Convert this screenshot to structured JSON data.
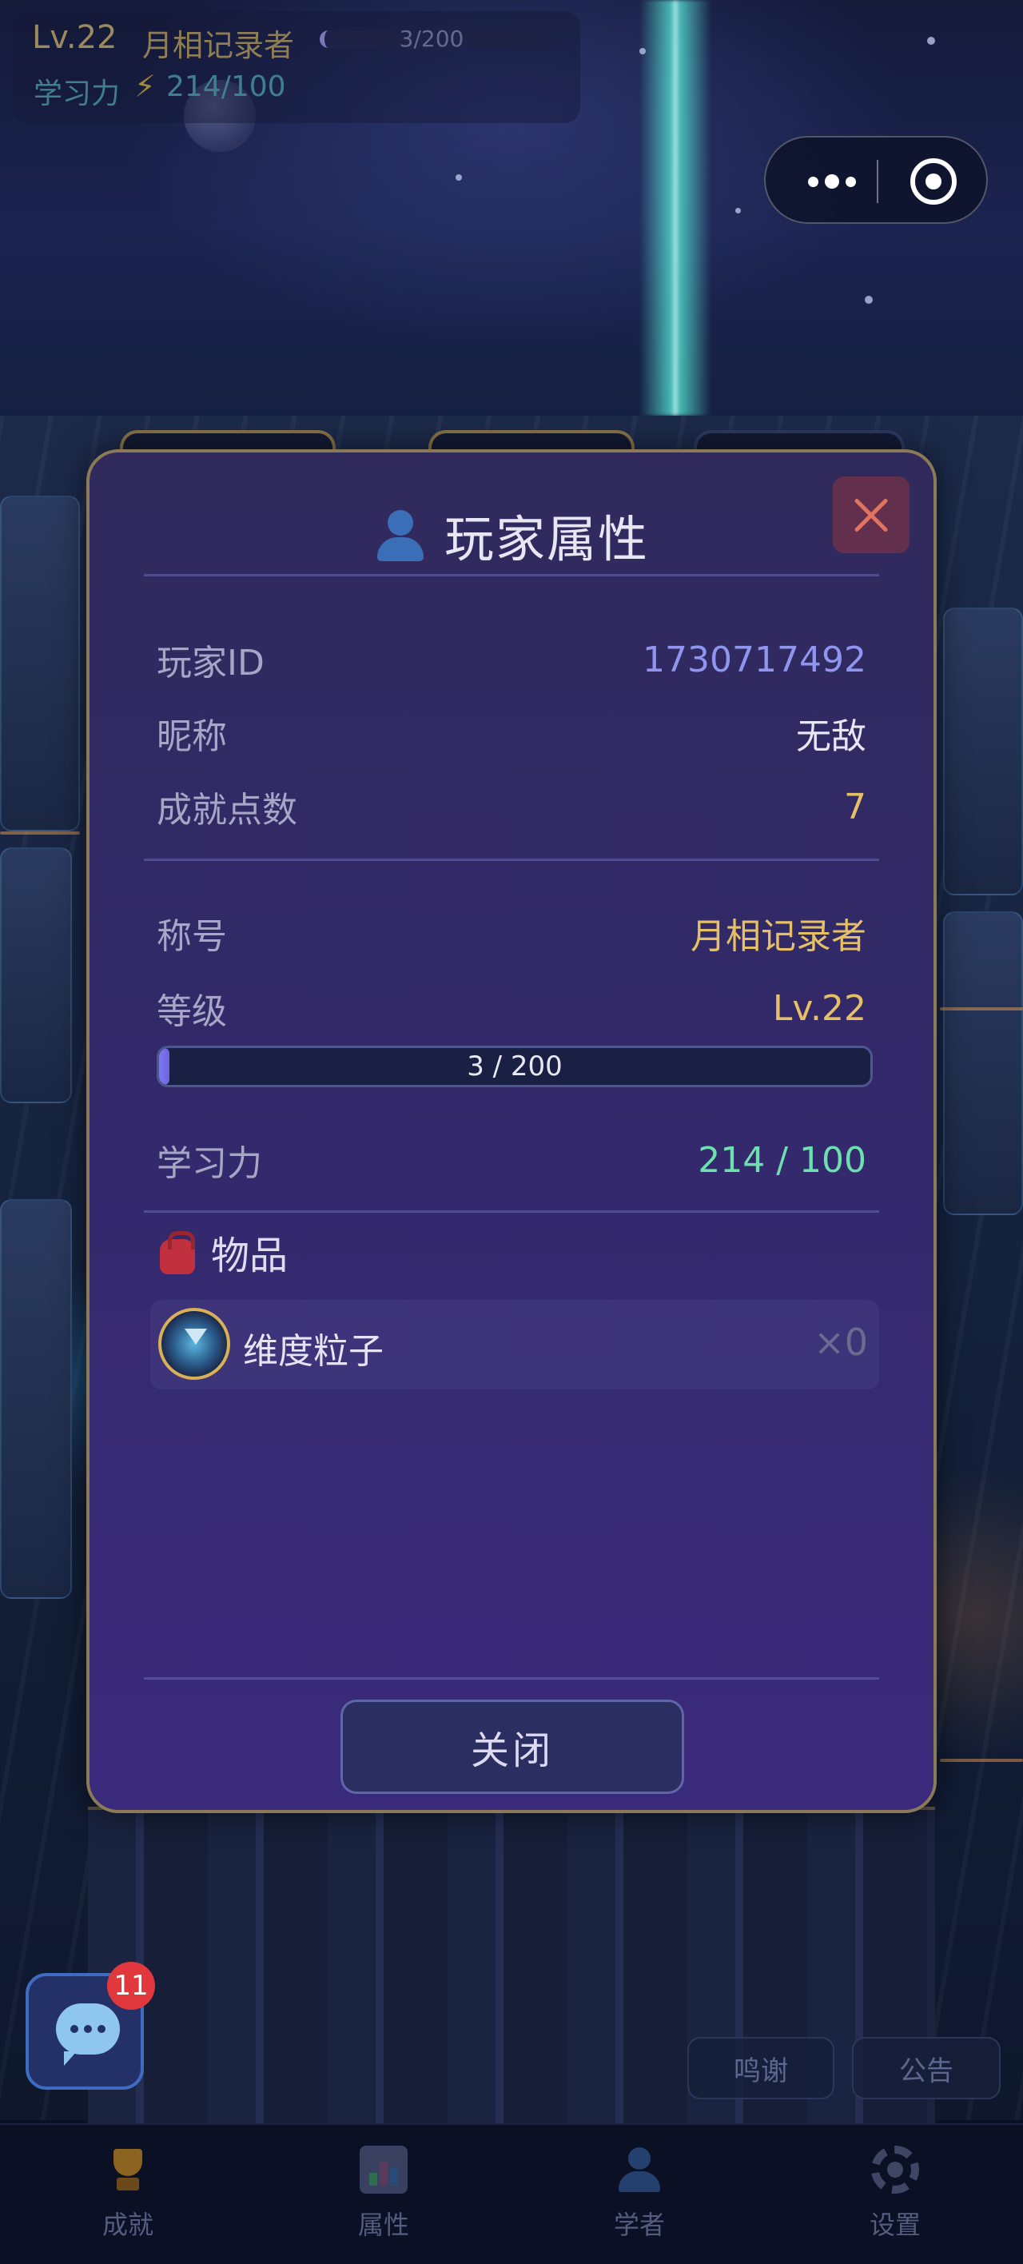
{
  "hud": {
    "level": "Lv.22",
    "title": "月相记录者",
    "exp_text": "3/200",
    "power_label": "学习力",
    "power_value": "214/100"
  },
  "modal": {
    "title": "玩家属性",
    "rows": {
      "player_id_label": "玩家ID",
      "player_id": "1730717492",
      "nickname_label": "昵称",
      "nickname": "无敌",
      "achievement_label": "成就点数",
      "achievement_points": "7",
      "rank_label": "称号",
      "rank": "月相记录者",
      "level_label": "等级",
      "level": "Lv.22",
      "exp_text": "3 / 200",
      "exp_progress": 0.015,
      "power_label": "学习力",
      "power_value": "214 / 100"
    },
    "items_title": "物品",
    "items": [
      {
        "name": "维度粒子",
        "count": "×0"
      }
    ],
    "close_label": "关闭"
  },
  "chat": {
    "badge": "11"
  },
  "side_buttons": {
    "thanks": "鸣谢",
    "notice": "公告"
  },
  "nav": [
    {
      "label": "成就",
      "icon": "trophy-icon"
    },
    {
      "label": "属性",
      "icon": "bar-chart-icon"
    },
    {
      "label": "学者",
      "icon": "scholar-icon"
    },
    {
      "label": "设置",
      "icon": "gear-icon"
    }
  ],
  "colors": {
    "player_id": "#8f96f0",
    "gold": "#e6c066",
    "power": "#6ee0b0",
    "nickname": "#e8e6f4"
  }
}
